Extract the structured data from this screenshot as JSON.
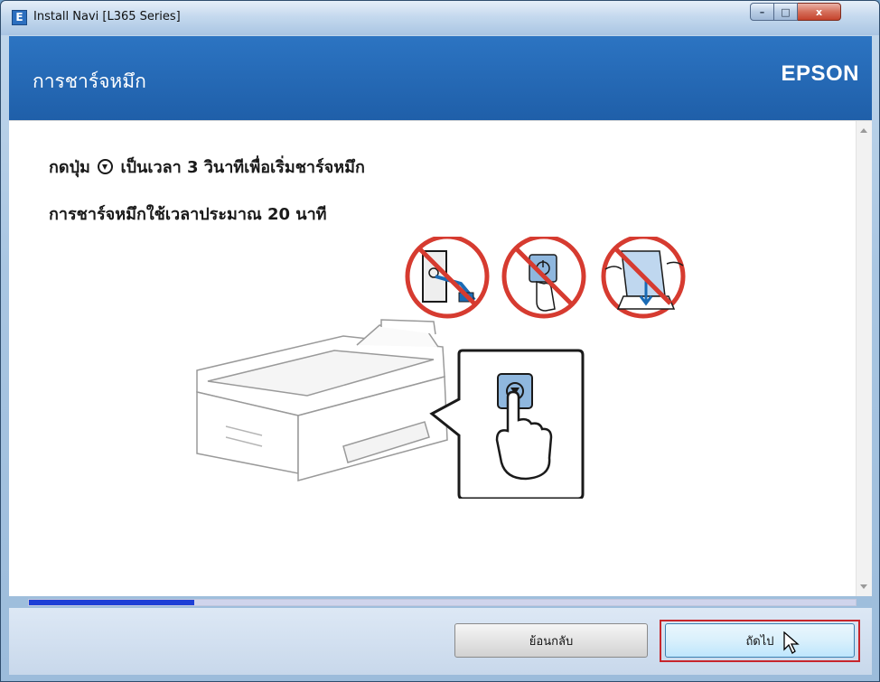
{
  "window": {
    "title": "Install Navi [L365 Series]",
    "app_icon_letter": "E",
    "controls": {
      "minimize": "–",
      "maximize": "□",
      "close": "x"
    }
  },
  "header": {
    "title": "การชาร์จหมึก",
    "brand": "EPSON"
  },
  "content": {
    "instruction_1_before": "กดปุ่ม",
    "instruction_1_after": "เป็นเวลา 3 วินาทีเพื่อเริ่มชาร์จหมึก",
    "instruction_2": "การชาร์จหมึกใช้เวลาประมาณ 20 นาที",
    "illustration_icons": [
      "do-not-unplug-icon",
      "do-not-press-power-icon",
      "do-not-load-paper-icon",
      "printer-illustration",
      "press-stop-button-icon"
    ]
  },
  "progress": {
    "value_percent": 20,
    "fill_color": "#1d3fd6"
  },
  "footer": {
    "back_label": "ย้อนกลับ",
    "next_label": "ถัดไป"
  }
}
